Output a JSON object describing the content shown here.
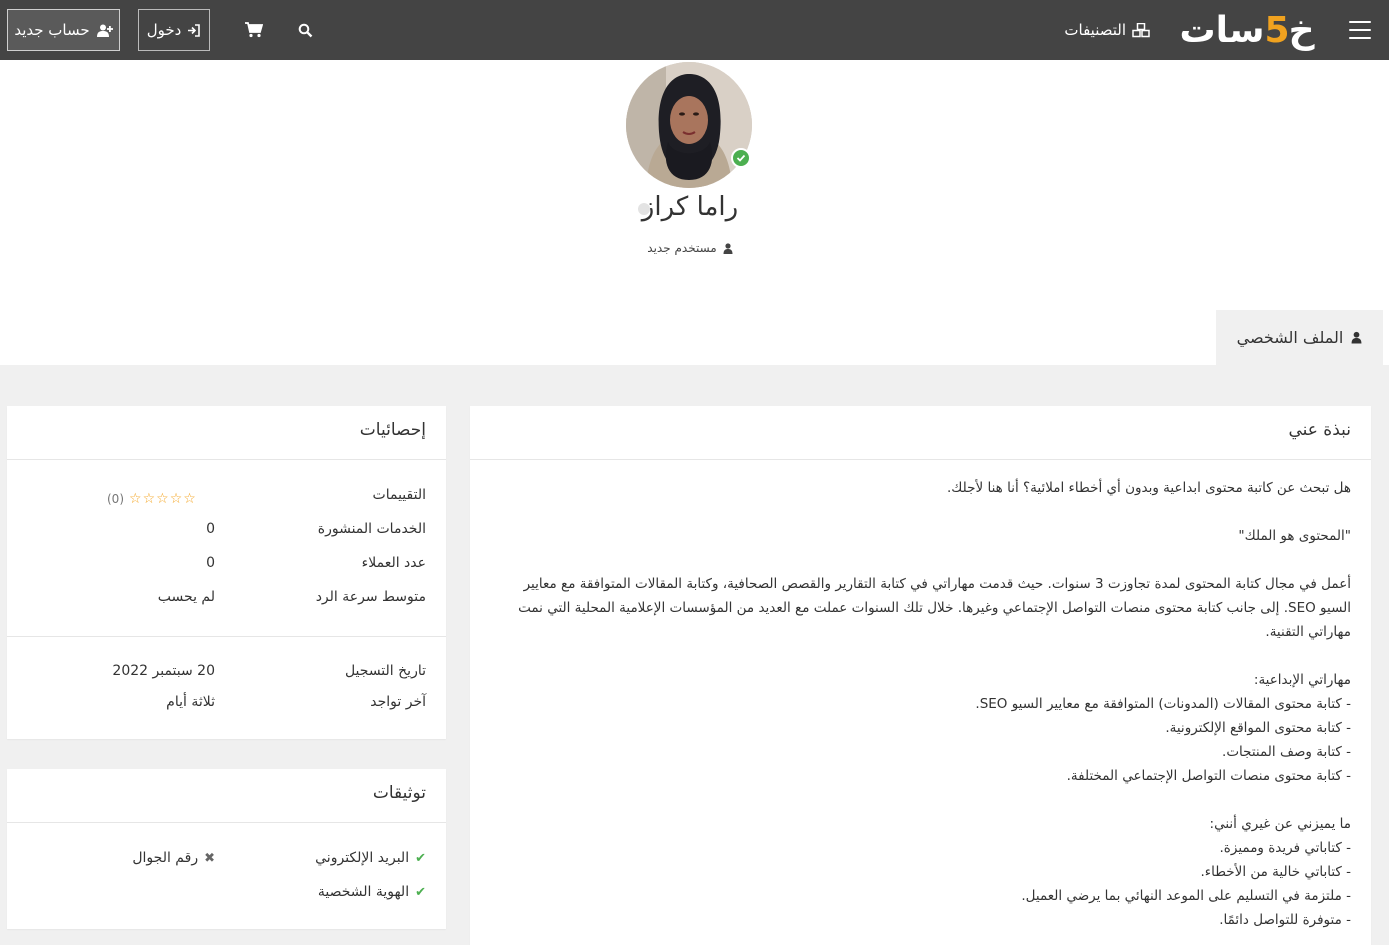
{
  "nav": {
    "register_label": "حساب جديد",
    "login_label": "دخول",
    "categories_label": "التصنيفات",
    "logo": {
      "prefix": "خ",
      "number": "5",
      "suffix": "سات"
    },
    "icons": [
      "user-plus-icon",
      "sign-in-icon",
      "cart-icon",
      "search-icon",
      "cubes-icon",
      "hamburger-icon"
    ]
  },
  "profile": {
    "name": "راما كراز",
    "level": "مستخدم جديد",
    "verified": true,
    "online": false,
    "tab_label": "الملف الشخصي"
  },
  "about": {
    "title": "نبذة عني",
    "lines": [
      "هل تبحث عن كاتبة محتوى ابداعية وبدون أي أخطاء املائية؟ أنا هنا لأجلك.",
      "",
      "\"المحتوى هو الملك\"",
      "",
      "أعمل في مجال كتابة المحتوى لمدة تجاوزت 3 سنوات. حيث قدمت مهاراتي في كتابة التقارير والقصص الصحافية، وكتابة المقالات المتوافقة مع معايير السيو SEO. إلى جانب كتابة محتوى منصات التواصل الإجتماعي وغيرها. خلال تلك السنوات عملت مع العديد من المؤسسات الإعلامية المحلية التي نمت مهاراتي التقنية.",
      "",
      "مهاراتي الإبداعية:",
      "- كتابة محتوى المقالات (المدونات) المتوافقة مع معايير السيو SEO.",
      "- كتابة محتوى المواقع الإلكترونية.",
      "- كتابة وصف المنتجات.",
      "- كتابة محتوى منصات التواصل الإجتماعي المختلفة.",
      "",
      "ما يميزني عن غيري أنني:",
      "- كتاباتي فريدة ومميزة.",
      "- كتاباتي خالية من الأخطاء.",
      "- ملتزمة في التسليم على الموعد النهائي بما يرضي العميل.",
      "- متوفرة للتواصل دائمًا."
    ]
  },
  "stats": {
    "title": "إحصائيات",
    "ratings_label": "التقييمات",
    "ratings_count": "(0)",
    "ratings_stars": 0,
    "published_services_label": "الخدمات المنشورة",
    "published_services": "0",
    "clients_label": "عدد العملاء",
    "clients": "0",
    "response_label": "متوسط سرعة الرد",
    "response": "لم يحسب",
    "registered_label": "تاريخ التسجيل",
    "registered": "20 سبتمبر 2022",
    "last_seen_label": "آخر تواجد",
    "last_seen": "ثلاثة أيام"
  },
  "verifications": {
    "title": "توثيقات",
    "email_label": "البريد الإلكتروني",
    "email_verified": true,
    "id_label": "الهوية الشخصية",
    "id_verified": true,
    "phone_label": "رقم الجوال",
    "phone_verified": false
  },
  "colors": {
    "navbar": "#444444",
    "accent": "#f0a21f",
    "verified": "#4caf50",
    "page_bg": "#f0f0f0"
  }
}
